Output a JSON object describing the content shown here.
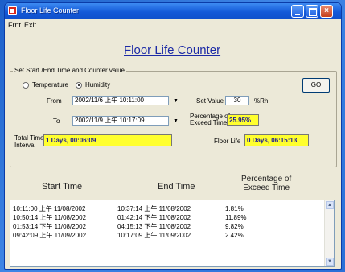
{
  "window": {
    "title": "Floor Life Counter",
    "controls": {
      "minimize": "",
      "maximize": "",
      "close": "×"
    }
  },
  "menu": {
    "items": [
      "Frnt",
      "Exit"
    ]
  },
  "app_title": "Floor Life Counter",
  "settings": {
    "group_label": "Set Start /End Time and Counter value",
    "mode_options": [
      {
        "label": "Temperature",
        "checked": false
      },
      {
        "label": "Humidity",
        "checked": true
      }
    ],
    "go_button": "GO",
    "from_label": "From",
    "from_value": "2002/11/6 上午 10:11:00",
    "to_label": "To",
    "to_value": "2002/11/9 上午 10:17:09",
    "set_value_label": "Set Value",
    "set_value": "30",
    "set_value_unit": "%Rh",
    "percentage_label_line1": "Percentage of",
    "percentage_label_line2": "Exceed Time",
    "percentage_value": "25.95%",
    "total_time_label_line1": "Total Time",
    "total_time_label_line2": "Interval",
    "total_time_value": "1 Days, 00:06:09",
    "floor_life_label": "Floor Life",
    "floor_life_value": "0 Days, 06:15:13"
  },
  "table": {
    "headers": {
      "start": "Start Time",
      "end": "End Time",
      "percent_line1": "Percentage of",
      "percent_line2": "Exceed Time"
    },
    "rows": [
      {
        "start": "10:11:00 上午 11/08/2002",
        "end": "10:37:14 上午 11/08/2002",
        "percent": "1.81%"
      },
      {
        "start": "10:50:14 上午 11/08/2002",
        "end": "01:42:14 下午 11/08/2002",
        "percent": "11.89%"
      },
      {
        "start": "01:53:14 下午 11/08/2002",
        "end": "04:15:13 下午 11/08/2002",
        "percent": "9.82%"
      },
      {
        "start": "09:42:09 上午 11/09/2002",
        "end": "10:17:09 上午 11/09/2002",
        "percent": "2.42%"
      }
    ]
  },
  "icons": {
    "app": "app-icon",
    "combo_arrow": "chevron-down-icon",
    "scroll_up": "scroll-up-icon",
    "scroll_down": "scroll-down-icon"
  },
  "colors": {
    "titlebar": "#1359d8",
    "highlight": "#ffff2e",
    "title_text": "#1c2aa6"
  }
}
